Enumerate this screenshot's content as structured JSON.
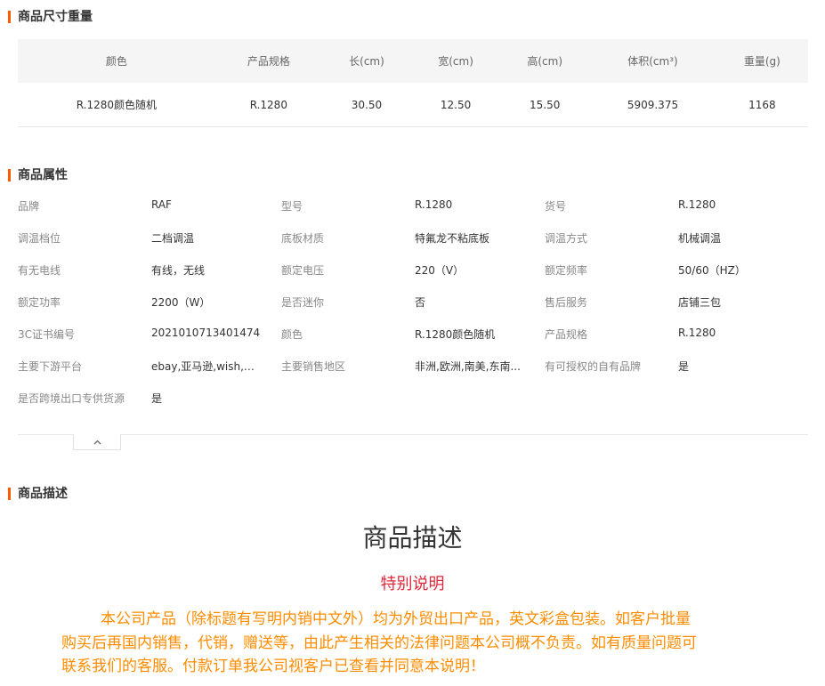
{
  "size_section": {
    "title": "商品尺寸重量",
    "headers": [
      "颜色",
      "产品规格",
      "长(cm)",
      "宽(cm)",
      "高(cm)",
      "体积(cm³)",
      "重量(g)"
    ],
    "row": [
      "R.1280颜色随机",
      "R.1280",
      "30.50",
      "12.50",
      "15.50",
      "5909.375",
      "1168"
    ]
  },
  "attr_section": {
    "title": "商品属性",
    "rows": [
      [
        [
          "品牌",
          "RAF"
        ],
        [
          "型号",
          "R.1280"
        ],
        [
          "货号",
          "R.1280"
        ]
      ],
      [
        [
          "调温档位",
          "二档调温"
        ],
        [
          "底板材质",
          "特氟龙不粘底板"
        ],
        [
          "调温方式",
          "机械调温"
        ]
      ],
      [
        [
          "有无电线",
          "有线，无线"
        ],
        [
          "额定电压",
          "220（V）"
        ],
        [
          "额定频率",
          "50/60（HZ）"
        ]
      ],
      [
        [
          "额定功率",
          "2200（W）"
        ],
        [
          "是否迷你",
          "否"
        ],
        [
          "售后服务",
          "店铺三包"
        ]
      ],
      [
        [
          "3C证书编号",
          "2021010713401474"
        ],
        [
          "颜色",
          "R.1280颜色随机"
        ],
        [
          "产品规格",
          "R.1280"
        ]
      ],
      [
        [
          "主要下游平台",
          "ebay,亚马逊,wish,速..."
        ],
        [
          "主要销售地区",
          "非洲,欧洲,南美,东南..."
        ],
        [
          "有可授权的自有品牌",
          "是"
        ]
      ],
      [
        [
          "是否跨境出口专供货源",
          "是"
        ]
      ]
    ]
  },
  "desc_section": {
    "title": "商品描述",
    "heading": "商品描述",
    "subheading": "特别说明",
    "body_lines": [
      "本公司产品（除标题有写明内销中文外）均为外贸出口产品，英文彩盒包装。如客户批量",
      "购买后再国内销售，代销，赠送等，由此产生相关的法律问题本公司概不负责。如有质量问题可",
      "联系我们的客服。付款订单我公司视客户已查看并同意本说明！"
    ]
  },
  "icons": {
    "collapse": "chevron-up-icon"
  },
  "colors": {
    "accent": "#ff5a00",
    "subheading": "#e0283c",
    "body_text": "#ff8c00"
  }
}
